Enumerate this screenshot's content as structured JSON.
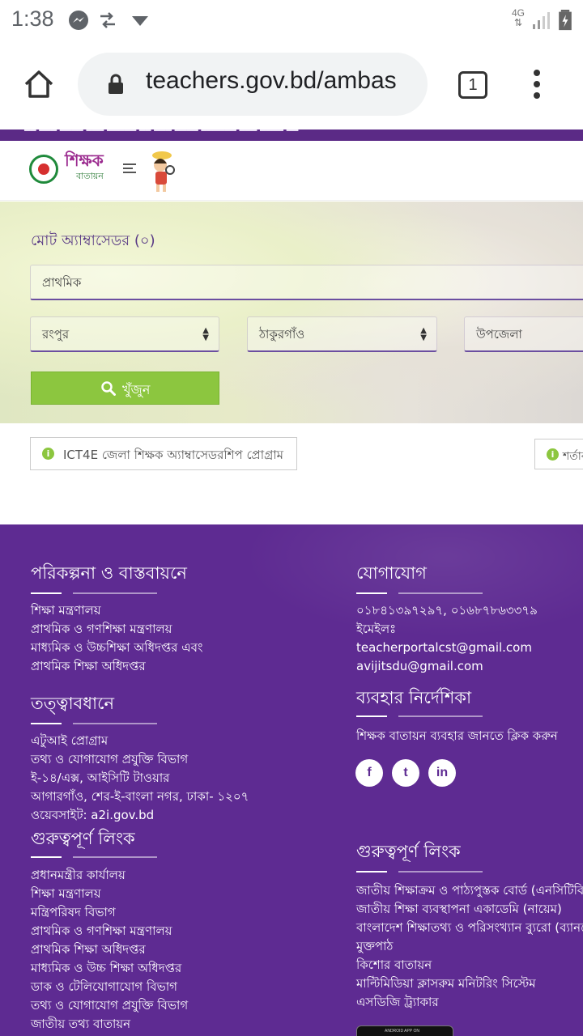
{
  "status_bar": {
    "time": "1:38",
    "network": "4G"
  },
  "browser": {
    "url": "teachers.gov.bd/ambas",
    "tab_count": "1"
  },
  "site": {
    "brand_name": "শিক্ষক",
    "brand_sub": "বাতায়ন"
  },
  "search": {
    "total_label": "মোট অ্যাম্বাসেডর (০)",
    "level_value": "প্রাথমিক",
    "division_value": "রংপুর",
    "district_value": "ঠাকুরগাঁও",
    "upazila_value": "উপজেলা",
    "button_label": "খুঁজুন"
  },
  "info": {
    "program_label": "ICT4E জেলা শিক্ষক অ্যাম্বাসেডরশিপ প্রোগ্রাম",
    "terms_label": "শর্তাব"
  },
  "footer": {
    "planning": {
      "title": "পরিকল্পনা ও বাস্তবায়নে",
      "items": [
        "শিক্ষা মন্ত্রণালয়",
        "প্রাথমিক ও গণশিক্ষা মন্ত্রণালয়",
        "মাধ্যমিক ও উচ্চশিক্ষা অধিদপ্তর এবং",
        "প্রাথমিক শিক্ষা অধিদপ্তর"
      ]
    },
    "supervision": {
      "title": "তত্ত্বাবধানে",
      "items": [
        "এটুআই প্রোগ্রাম",
        "তথ্য ও যোগাযোগ প্রযুক্তি বিভাগ",
        "ই-১৪/এক্স, আইসিটি টাওয়ার",
        "আগারগাঁও, শের-ই-বাংলা নগর, ঢাকা- ১২০৭",
        "ওয়েবসাইট: a2i.gov.bd"
      ]
    },
    "important_links_left": {
      "title": "গুরুত্বপূর্ণ লিংক",
      "items": [
        "প্রধানমন্ত্রীর কার্যালয়",
        "শিক্ষা মন্ত্রণালয়",
        "মন্ত্রিপরিষদ বিভাগ",
        "প্রাথমিক ও গণশিক্ষা মন্ত্রণালয়",
        "প্রাথমিক শিক্ষা অধিদপ্তর",
        "মাধ্যমিক ও উচ্চ শিক্ষা অধিদপ্তর",
        "ডাক ও টেলিযোগাযোগ বিভাগ",
        "তথ্য ও যোগাযোগ প্রযুক্তি বিভাগ",
        "জাতীয় তথ্য বাতায়ন"
      ]
    },
    "contact": {
      "title": "যোগাযোগ",
      "phones": "০১৮৪১৩৯৭২৯৭, ০১৬৮৭৮৬৩৩৭৯",
      "email_label": "ইমেইলঃ",
      "email1": "teacherportalcst@gmail.com",
      "email2": "avijitsdu@gmail.com"
    },
    "guide": {
      "title": "ব্যবহার নির্দেশিকা",
      "text": "শিক্ষক বাতায়ন ব্যবহার জানতে ক্লিক করুন"
    },
    "social": {
      "facebook": "f",
      "twitter": "t",
      "linkedin": "in"
    },
    "important_links_right": {
      "title": "গুরুত্বপূর্ণ লিংক",
      "items": [
        "জাতীয় শিক্ষাক্রম ও পাঠ্যপুস্তক বোর্ড (এনসিটিবি)",
        "জাতীয় শিক্ষা ব্যবস্থাপনা একাডেমি (নায়েম)",
        "বাংলাদেশ শিক্ষাতথ্য ও পরিসংখ্যান ব্যুরো (ব্যানবেইস)",
        "মুক্তপাঠ",
        "কিশোর বাতায়ন",
        "মাল্টিমিডিয়া ক্লাসরুম মনিটরিং সিস্টেম",
        "এসডিজি ট্র্যাকার"
      ]
    },
    "app_badge": "ANDROID APP ON"
  },
  "colors": {
    "brand_purple": "#5e2b92",
    "search_green": "#8cc63f"
  }
}
